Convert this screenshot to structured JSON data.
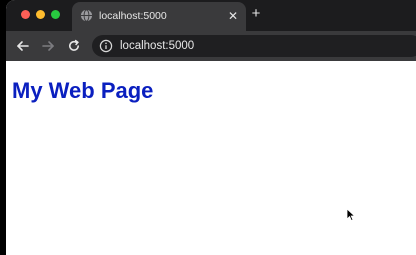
{
  "browser": {
    "window_controls": [
      "close",
      "minimize",
      "maximize"
    ],
    "tab": {
      "title": "localhost:5000",
      "favicon": "globe-icon",
      "close_glyph": "✕"
    },
    "new_tab_glyph": "+",
    "toolbar": {
      "back_icon": "arrow-left-icon",
      "forward_icon": "arrow-right-icon",
      "reload_icon": "reload-icon",
      "url": "localhost:5000",
      "site_info_icon": "info-icon"
    }
  },
  "page": {
    "heading": "My Web Page",
    "heading_color": "#0a1fbf"
  },
  "colors": {
    "tabbar_bg": "#1c1c1e",
    "toolbar_bg": "#3a3a3c",
    "omnibox_bg": "#1f1f21",
    "traffic_red": "#ff5f57",
    "traffic_yellow": "#febc2e",
    "traffic_green": "#28c840"
  }
}
